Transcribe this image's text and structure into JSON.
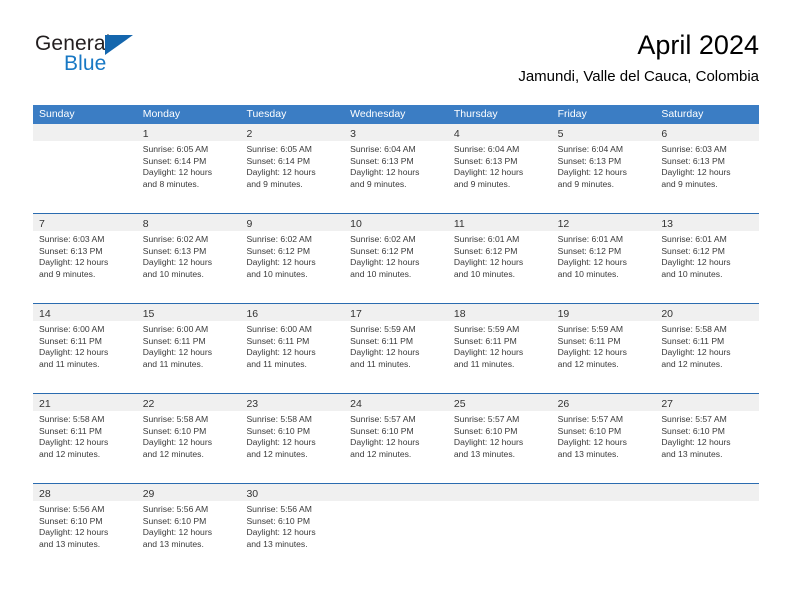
{
  "brand": {
    "name_part1": "General",
    "name_part2": "Blue",
    "triangle_icon": "blue-triangle-logo"
  },
  "header": {
    "title": "April 2024",
    "subtitle": "Jamundi, Valle del Cauca, Colombia"
  },
  "colors": {
    "header_blue": "#3b7dc4",
    "row_divider_blue": "#2b6cb0",
    "day_band_gray": "#f0f0f0",
    "brand_blue": "#1878c4",
    "text_dark": "#3a3a3a"
  },
  "weekdays": [
    "Sunday",
    "Monday",
    "Tuesday",
    "Wednesday",
    "Thursday",
    "Friday",
    "Saturday"
  ],
  "weeks": [
    [
      {
        "day": "",
        "lines": []
      },
      {
        "day": "1",
        "lines": [
          "Sunrise: 6:05 AM",
          "Sunset: 6:14 PM",
          "Daylight: 12 hours",
          "and 8 minutes."
        ]
      },
      {
        "day": "2",
        "lines": [
          "Sunrise: 6:05 AM",
          "Sunset: 6:14 PM",
          "Daylight: 12 hours",
          "and 9 minutes."
        ]
      },
      {
        "day": "3",
        "lines": [
          "Sunrise: 6:04 AM",
          "Sunset: 6:13 PM",
          "Daylight: 12 hours",
          "and 9 minutes."
        ]
      },
      {
        "day": "4",
        "lines": [
          "Sunrise: 6:04 AM",
          "Sunset: 6:13 PM",
          "Daylight: 12 hours",
          "and 9 minutes."
        ]
      },
      {
        "day": "5",
        "lines": [
          "Sunrise: 6:04 AM",
          "Sunset: 6:13 PM",
          "Daylight: 12 hours",
          "and 9 minutes."
        ]
      },
      {
        "day": "6",
        "lines": [
          "Sunrise: 6:03 AM",
          "Sunset: 6:13 PM",
          "Daylight: 12 hours",
          "and 9 minutes."
        ]
      }
    ],
    [
      {
        "day": "7",
        "lines": [
          "Sunrise: 6:03 AM",
          "Sunset: 6:13 PM",
          "Daylight: 12 hours",
          "and 9 minutes."
        ]
      },
      {
        "day": "8",
        "lines": [
          "Sunrise: 6:02 AM",
          "Sunset: 6:13 PM",
          "Daylight: 12 hours",
          "and 10 minutes."
        ]
      },
      {
        "day": "9",
        "lines": [
          "Sunrise: 6:02 AM",
          "Sunset: 6:12 PM",
          "Daylight: 12 hours",
          "and 10 minutes."
        ]
      },
      {
        "day": "10",
        "lines": [
          "Sunrise: 6:02 AM",
          "Sunset: 6:12 PM",
          "Daylight: 12 hours",
          "and 10 minutes."
        ]
      },
      {
        "day": "11",
        "lines": [
          "Sunrise: 6:01 AM",
          "Sunset: 6:12 PM",
          "Daylight: 12 hours",
          "and 10 minutes."
        ]
      },
      {
        "day": "12",
        "lines": [
          "Sunrise: 6:01 AM",
          "Sunset: 6:12 PM",
          "Daylight: 12 hours",
          "and 10 minutes."
        ]
      },
      {
        "day": "13",
        "lines": [
          "Sunrise: 6:01 AM",
          "Sunset: 6:12 PM",
          "Daylight: 12 hours",
          "and 10 minutes."
        ]
      }
    ],
    [
      {
        "day": "14",
        "lines": [
          "Sunrise: 6:00 AM",
          "Sunset: 6:11 PM",
          "Daylight: 12 hours",
          "and 11 minutes."
        ]
      },
      {
        "day": "15",
        "lines": [
          "Sunrise: 6:00 AM",
          "Sunset: 6:11 PM",
          "Daylight: 12 hours",
          "and 11 minutes."
        ]
      },
      {
        "day": "16",
        "lines": [
          "Sunrise: 6:00 AM",
          "Sunset: 6:11 PM",
          "Daylight: 12 hours",
          "and 11 minutes."
        ]
      },
      {
        "day": "17",
        "lines": [
          "Sunrise: 5:59 AM",
          "Sunset: 6:11 PM",
          "Daylight: 12 hours",
          "and 11 minutes."
        ]
      },
      {
        "day": "18",
        "lines": [
          "Sunrise: 5:59 AM",
          "Sunset: 6:11 PM",
          "Daylight: 12 hours",
          "and 11 minutes."
        ]
      },
      {
        "day": "19",
        "lines": [
          "Sunrise: 5:59 AM",
          "Sunset: 6:11 PM",
          "Daylight: 12 hours",
          "and 12 minutes."
        ]
      },
      {
        "day": "20",
        "lines": [
          "Sunrise: 5:58 AM",
          "Sunset: 6:11 PM",
          "Daylight: 12 hours",
          "and 12 minutes."
        ]
      }
    ],
    [
      {
        "day": "21",
        "lines": [
          "Sunrise: 5:58 AM",
          "Sunset: 6:11 PM",
          "Daylight: 12 hours",
          "and 12 minutes."
        ]
      },
      {
        "day": "22",
        "lines": [
          "Sunrise: 5:58 AM",
          "Sunset: 6:10 PM",
          "Daylight: 12 hours",
          "and 12 minutes."
        ]
      },
      {
        "day": "23",
        "lines": [
          "Sunrise: 5:58 AM",
          "Sunset: 6:10 PM",
          "Daylight: 12 hours",
          "and 12 minutes."
        ]
      },
      {
        "day": "24",
        "lines": [
          "Sunrise: 5:57 AM",
          "Sunset: 6:10 PM",
          "Daylight: 12 hours",
          "and 12 minutes."
        ]
      },
      {
        "day": "25",
        "lines": [
          "Sunrise: 5:57 AM",
          "Sunset: 6:10 PM",
          "Daylight: 12 hours",
          "and 13 minutes."
        ]
      },
      {
        "day": "26",
        "lines": [
          "Sunrise: 5:57 AM",
          "Sunset: 6:10 PM",
          "Daylight: 12 hours",
          "and 13 minutes."
        ]
      },
      {
        "day": "27",
        "lines": [
          "Sunrise: 5:57 AM",
          "Sunset: 6:10 PM",
          "Daylight: 12 hours",
          "and 13 minutes."
        ]
      }
    ],
    [
      {
        "day": "28",
        "lines": [
          "Sunrise: 5:56 AM",
          "Sunset: 6:10 PM",
          "Daylight: 12 hours",
          "and 13 minutes."
        ]
      },
      {
        "day": "29",
        "lines": [
          "Sunrise: 5:56 AM",
          "Sunset: 6:10 PM",
          "Daylight: 12 hours",
          "and 13 minutes."
        ]
      },
      {
        "day": "30",
        "lines": [
          "Sunrise: 5:56 AM",
          "Sunset: 6:10 PM",
          "Daylight: 12 hours",
          "and 13 minutes."
        ]
      },
      {
        "day": "",
        "lines": []
      },
      {
        "day": "",
        "lines": []
      },
      {
        "day": "",
        "lines": []
      },
      {
        "day": "",
        "lines": []
      }
    ]
  ]
}
